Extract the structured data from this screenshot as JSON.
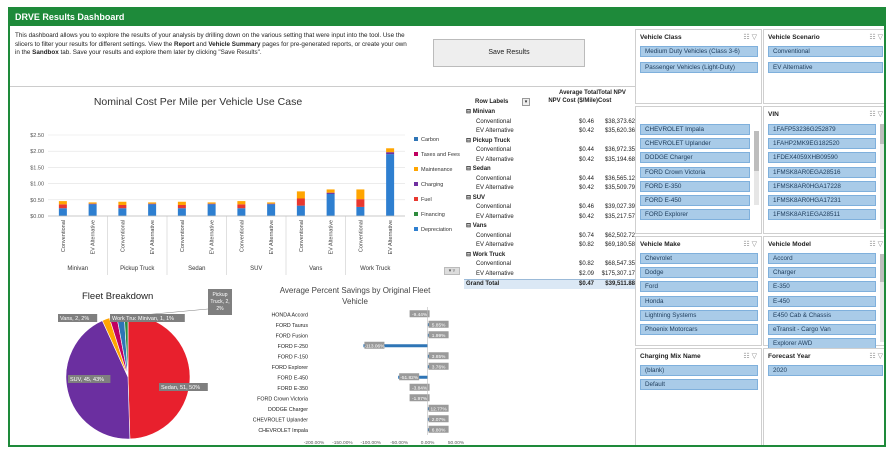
{
  "header": {
    "title": "DRVE Results Dashboard"
  },
  "intro": {
    "t1": "This dashboard allows you to explore the results of your analysis by drilling down on the various setting that were input into the tool. Use the slicers to filter your results for different settings. View the ",
    "b1": "Report",
    "t2": " and ",
    "b2": "Vehicle Summary",
    "t3": " pages for pre-generated reports, or create your own in the ",
    "b3": "Sandbox",
    "t4": " tab. Save your results and explore them later by clicking \"Save Results\"."
  },
  "save_button": "Save Results",
  "bar_chart": {
    "chart_data": {
      "type": "bar",
      "stacked": true,
      "title": "Nominal Cost Per Mile per Vehicle Use Case",
      "y_ticks": [
        "$2.50",
        "$2.00",
        "$1.50",
        "$1.00",
        "$0.50",
        "$0.00"
      ],
      "ylim": [
        0,
        2.5
      ],
      "groups": [
        "Minivan",
        "Pickup Truck",
        "Sedan",
        "SUV",
        "Vans",
        "Work Truck"
      ],
      "categories": [
        "Conventional",
        "EV Alternative",
        "Conventional",
        "EV Alternative",
        "Conventional",
        "EV Alternative",
        "Conventional",
        "EV Alternative",
        "Conventional",
        "EV Alternative",
        "Conventional",
        "EV Alternative"
      ],
      "legend_placement": "right",
      "series": [
        {
          "name": "Carbon",
          "color": "#2e75b6",
          "values": [
            0,
            0,
            0,
            0,
            0,
            0,
            0,
            0,
            0,
            0,
            0,
            0
          ]
        },
        {
          "name": "Taxes and Fees",
          "color": "#c00060",
          "values": [
            0,
            0,
            0,
            0,
            0,
            0,
            0,
            0,
            0,
            0,
            0,
            0
          ]
        },
        {
          "name": "Maintenance",
          "color": "#ffa500",
          "values": [
            0.1,
            0.04,
            0.1,
            0.04,
            0.1,
            0.04,
            0.1,
            0.04,
            0.22,
            0.1,
            0.3,
            0.12
          ]
        },
        {
          "name": "Charging",
          "color": "#7030a0",
          "values": [
            0,
            0.02,
            0,
            0.02,
            0,
            0.02,
            0,
            0.02,
            0,
            0.04,
            0,
            0.06
          ]
        },
        {
          "name": "Fuel",
          "color": "#e8382f",
          "values": [
            0.12,
            0,
            0.1,
            0,
            0.1,
            0,
            0.12,
            0,
            0.22,
            0,
            0.24,
            0
          ]
        },
        {
          "name": "Financing",
          "color": "#2e8b3d",
          "values": [
            0,
            0,
            0,
            0,
            0,
            0,
            0,
            0,
            0,
            0,
            0,
            0
          ]
        },
        {
          "name": "Depreciation",
          "color": "#2e7fd0",
          "values": [
            0.24,
            0.36,
            0.24,
            0.36,
            0.24,
            0.36,
            0.24,
            0.36,
            0.32,
            0.68,
            0.28,
            1.91
          ]
        }
      ]
    }
  },
  "pie_chart": {
    "chart_data": {
      "type": "pie",
      "title": "Fleet Breakdown",
      "slices": [
        {
          "label": "Sedan, 51, 50%",
          "value": 51,
          "color": "#e8202d"
        },
        {
          "label": "SUV, 45, 43%",
          "value": 45,
          "color": "#6b2fa0"
        },
        {
          "label": "Vans, 2, 2%",
          "value": 2,
          "color": "#ffa500"
        },
        {
          "label": "Work Truck, 2, 2%",
          "value": 2,
          "color": "#c00060"
        },
        {
          "label": "Pickup Truck, 2, 2%",
          "value": 2,
          "color": "#2e75b6"
        },
        {
          "label": "Minivan, 1, 1%",
          "value": 1,
          "color": "#2e8b3d"
        }
      ]
    },
    "callout_pickup": [
      "Pickup",
      "Truck, 2,",
      "2%"
    ],
    "callout_work": "Work Truck, 2, 2%",
    "callout_minivan": "Minivan, 1, 1%"
  },
  "savings_chart": {
    "chart_data": {
      "type": "bar",
      "orientation": "horizontal",
      "title": "Average Percent Savings by Original Fleet Vehicle",
      "x_ticks": [
        "-200.00%",
        "-150.00%",
        "-100.00%",
        "-50.00%",
        "0.00%",
        "50.00%"
      ],
      "xlim": [
        -200,
        50
      ],
      "categories": [
        "HONDA Accord",
        "FORD Taurus",
        "FORD Fusion",
        "FORD F-250",
        "FORD F-150",
        "FORD Explorer",
        "FORD E-450",
        "FORD E-350",
        "FORD Crown Victoria",
        "DODGE Charger",
        "CHEVROLET Uplander",
        "CHEVROLET Impala"
      ],
      "values": [
        -9.44,
        5.85,
        1.99,
        -113.0,
        3.85,
        3.76,
        -51.82,
        -3.84,
        -1.97,
        12.77,
        2.07,
        6.8
      ],
      "data_labels": [
        "-9.44%",
        "5.85%",
        "1.99%",
        "-113.06%",
        "3.85%",
        "3.76%",
        "-51.82%",
        "-3.84%",
        "-1.97%",
        "12.77%",
        "2.07%",
        "6.80%"
      ],
      "bar_color": "#2e75b6"
    }
  },
  "pivot": {
    "headers": {
      "row_labels": "Row Labels",
      "col1": [
        "Average Total",
        "NPV Cost ($/Mile)"
      ],
      "col2": [
        "Total NPV",
        "Cost"
      ]
    },
    "rows": [
      {
        "label": "⊟ Minivan",
        "type": "group",
        "v1": "",
        "v2": ""
      },
      {
        "label": "Conventional",
        "type": "item",
        "v1": "$0.46",
        "v2": "$38,373.62"
      },
      {
        "label": "EV Alternative",
        "type": "item",
        "v1": "$0.42",
        "v2": "$35,620.36"
      },
      {
        "label": "⊟ Pickup Truck",
        "type": "group",
        "v1": "",
        "v2": ""
      },
      {
        "label": "Conventional",
        "type": "item",
        "v1": "$0.44",
        "v2": "$36,972.35"
      },
      {
        "label": "EV Alternative",
        "type": "item",
        "v1": "$0.42",
        "v2": "$35,194.68"
      },
      {
        "label": "⊟ Sedan",
        "type": "group",
        "v1": "",
        "v2": ""
      },
      {
        "label": "Conventional",
        "type": "item",
        "v1": "$0.44",
        "v2": "$36,565.12"
      },
      {
        "label": "EV Alternative",
        "type": "item",
        "v1": "$0.42",
        "v2": "$35,509.79"
      },
      {
        "label": "⊟ SUV",
        "type": "group",
        "v1": "",
        "v2": ""
      },
      {
        "label": "Conventional",
        "type": "item",
        "v1": "$0.46",
        "v2": "$39,027.39"
      },
      {
        "label": "EV Alternative",
        "type": "item",
        "v1": "$0.42",
        "v2": "$35,217.57"
      },
      {
        "label": "⊟ Vans",
        "type": "group",
        "v1": "",
        "v2": ""
      },
      {
        "label": "Conventional",
        "type": "item",
        "v1": "$0.74",
        "v2": "$62,502.72"
      },
      {
        "label": "EV Alternative",
        "type": "item",
        "v1": "$0.82",
        "v2": "$69,180.58"
      },
      {
        "label": "⊟ Work Truck",
        "type": "group",
        "v1": "",
        "v2": ""
      },
      {
        "label": "Conventional",
        "type": "item",
        "v1": "$0.82",
        "v2": "$68,547.35"
      },
      {
        "label": "EV Alternative",
        "type": "item",
        "v1": "$2.09",
        "v2": "$175,307.17"
      },
      {
        "label": "Grand Total",
        "type": "total",
        "v1": "$0.47",
        "v2": "$39,511.88"
      }
    ]
  },
  "slicers": {
    "vehicle_class": {
      "title": "Vehicle Class",
      "items": [
        "Medium Duty Vehicles (Class 3-6)",
        "Passenger Vehicles (Light-Duty)"
      ]
    },
    "vehicle_scenario": {
      "title": "Vehicle Scenario",
      "items": [
        "Conventional",
        "EV Alternative"
      ]
    },
    "vehicle_model_top": {
      "title": "",
      "items": [
        "CHEVROLET Impala",
        "CHEVROLET Uplander",
        "DODGE Charger",
        "FORD Crown Victoria",
        "FORD E-350",
        "FORD E-450",
        "FORD Explorer"
      ]
    },
    "vin": {
      "title": "VIN",
      "items": [
        "1FAFP53236G252879",
        "1FAHP2MK9EG182520",
        "1FDEX4059XHB09590",
        "1FMSK8AR0EGA28516",
        "1FMSK8AR0HGA17228",
        "1FMSK8AR0HGA17231",
        "1FMSK8AR1EGA28511"
      ]
    },
    "vehicle_make": {
      "title": "Vehicle Make",
      "items": [
        "Chevrolet",
        "Dodge",
        "Ford",
        "Honda",
        "Lightning Systems",
        "Phoenix Motorcars"
      ]
    },
    "vehicle_model": {
      "title": "Vehicle Model",
      "items": [
        "Accord",
        "Charger",
        "E-350",
        "E-450",
        "E450 Cab & Chassis",
        "eTransit - Cargo Van",
        "Explorer AWD"
      ]
    },
    "charging_mix": {
      "title": "Charging Mix Name",
      "items": [
        "(blank)",
        "Default"
      ]
    },
    "forecast_year": {
      "title": "Forecast Year",
      "items": [
        "2020"
      ]
    }
  }
}
